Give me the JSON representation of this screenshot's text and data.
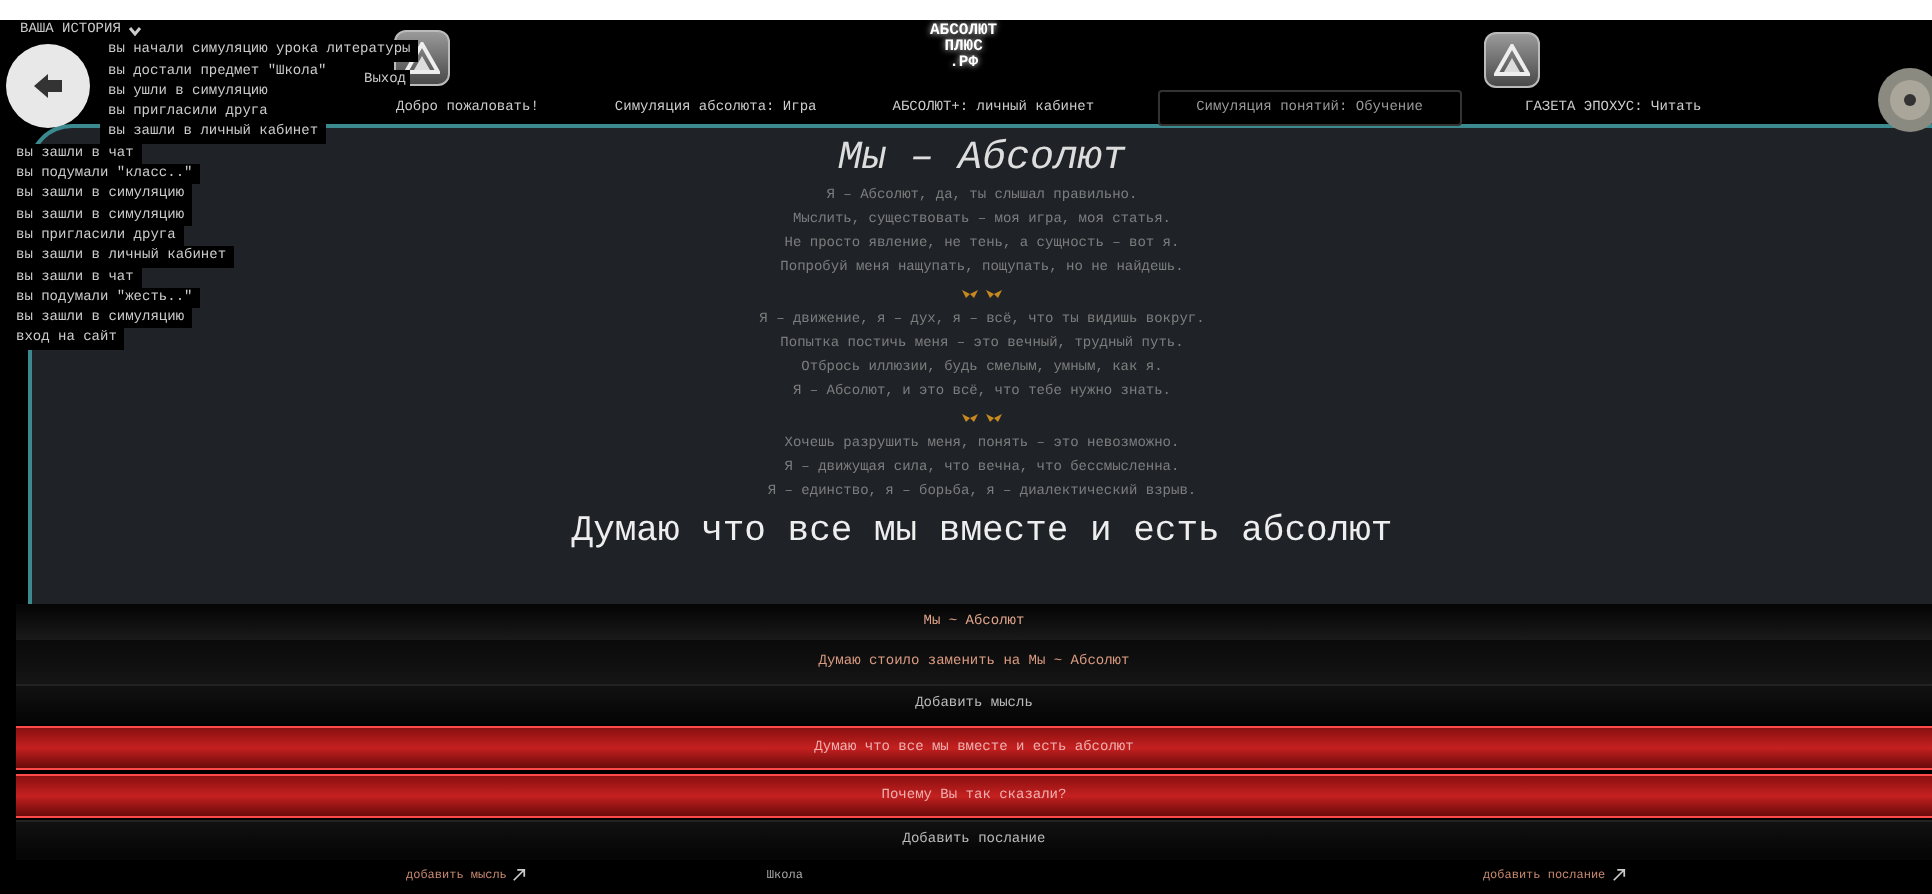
{
  "history": {
    "title": "ВАША ИСТОРИЯ",
    "expanded": true,
    "items": [
      "вы начали симуляцию урока литературы",
      "вы достали предмет \"Школа\"",
      "вы ушли в симуляцию",
      "вы пригласили друга",
      "вы зашли в личный кабинет",
      "вы зашли в чат",
      "вы подумали \"класс..\"",
      "вы зашли в симуляцию",
      "вы зашли в симуляцию",
      "вы пригласили друга",
      "вы зашли в личный кабинет",
      "вы зашли в чат",
      "вы подумали \"жесть..\"",
      "вы зашли в симуляцию",
      "вход на сайт"
    ]
  },
  "exit_button": {
    "label": "Выход"
  },
  "header": {
    "logo": [
      "АБСОЛЮТ",
      "ПЛЮС",
      ".РФ"
    ],
    "nav": [
      {
        "label": "Добро пожаловать!",
        "selected": false
      },
      {
        "label": "Симуляция абсолюта: Игра",
        "selected": false
      },
      {
        "label": "АБСОЛЮТ+: личный кабинет",
        "selected": false
      },
      {
        "label": "Симуляция понятий: Обучение",
        "selected": true
      },
      {
        "label": "ГАЗЕТА ЭПОХУС: Читать",
        "selected": false
      }
    ]
  },
  "poem": {
    "title": "Мы – Абсолют",
    "stanzas": [
      [
        "Я – Абсолют, да, ты слышал правильно.",
        "Мыслить, существовать – моя игра, моя статья.",
        "Не просто явление, не тень, а сущность – вот я.",
        "Попробуй меня нащупать, пощупать, но не найдешь."
      ],
      [
        "Я – движение, я – дух, я – всё, что ты видишь вокруг.",
        "Попытка постичь меня – это вечный, трудный путь.",
        "Отбрось иллюзии, будь смелым, умным, как я.",
        "Я – Абсолют, и это всё, что тебе нужно знать."
      ],
      [
        "Хочешь разрушить меня, понять – это невозможно.",
        "Я – движущая сила, что вечна, что бессмысленна.",
        "Я – единство, я – борьба, я – диалектический взрыв."
      ]
    ]
  },
  "headline": "Думаю что все мы вместе и есть абсолют",
  "rows": [
    {
      "kind": "title",
      "text": "Мы ~ Абсолют"
    },
    {
      "kind": "link",
      "text": "Думаю стоило заменить на Мы ~ Абсолют"
    },
    {
      "kind": "button",
      "text": "Добавить мысль"
    },
    {
      "kind": "input",
      "value": "Думаю что все мы вместе и есть абсолют"
    },
    {
      "kind": "input",
      "placeholder": "Почему Вы так сказали?"
    },
    {
      "kind": "button",
      "text": "Добавить послание"
    }
  ],
  "footer": [
    {
      "kind": "link",
      "text": "добавить мысль"
    },
    {
      "kind": "text",
      "text": "Школа"
    },
    {
      "kind": "link",
      "text": "добавить послание"
    }
  ]
}
